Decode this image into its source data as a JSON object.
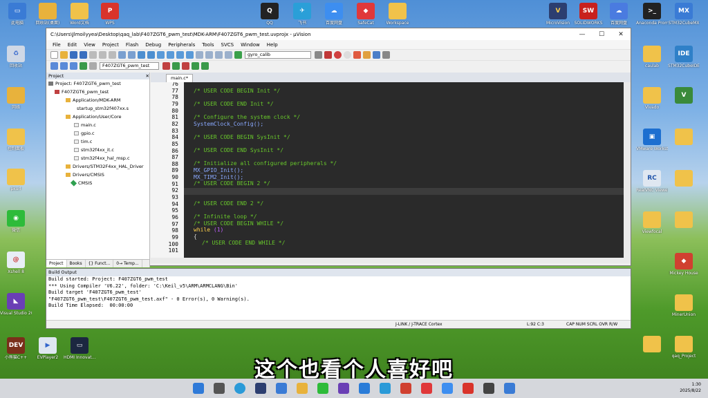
{
  "window": {
    "title": "C:\\Users\\Jlmoilyyea\\Desktop\\qaq_lab\\F407ZGT6_pwm_test\\MDK-ARM\\F407ZGT6_pwm_test.uvprojx - µVision"
  },
  "menu": [
    "File",
    "Edit",
    "View",
    "Project",
    "Flash",
    "Debug",
    "Peripherals",
    "Tools",
    "SVCS",
    "Window",
    "Help"
  ],
  "toolbar": {
    "target_select": "gyro_calib",
    "project_select": "F407ZGT6_pwm_test"
  },
  "project_pane": {
    "title": "Project",
    "tree": [
      "Project: F407ZGT6_pwm_test",
      "F407ZGT6_pwm_test",
      "Application/MDK-ARM",
      "startup_stm32f407xx.s",
      "Application/User/Core",
      "main.c",
      "gpio.c",
      "tim.c",
      "stm32f4xx_it.c",
      "stm32f4xx_hal_msp.c",
      "Drivers/STM32F4xx_HAL_Driver",
      "Drivers/CMSIS",
      "CMSIS"
    ],
    "tabs": [
      "Project",
      "Books",
      "{} Funct...",
      "0→ Temp..."
    ]
  },
  "editor": {
    "tab": "main.c*",
    "line_numbers": [
      "76",
      "77",
      "78",
      "79",
      "80",
      "81",
      "82",
      "83",
      "84",
      "85",
      "86",
      "87",
      "88",
      "89",
      "90",
      "91",
      "92",
      "93",
      "94",
      "95",
      "96",
      "97",
      "98",
      "99",
      "100",
      "101"
    ],
    "lines": {
      "l77": "/* USER CODE BEGIN Init */",
      "l79": "/* USER CODE END Init */",
      "l81": "/* Configure the system clock */",
      "l82": "SystemClock_Config();",
      "l84": "/* USER CODE BEGIN SysInit */",
      "l86": "/* USER CODE END SysInit */",
      "l88": "/* Initialize all configured peripherals */",
      "l89": "MX_GPIO_Init();",
      "l90": "MX_TIM2_Init();",
      "l91": "/* USER CODE BEGIN 2 */",
      "l94": "/* USER CODE END 2 */",
      "l96": "/* Infinite loop */",
      "l97": "/* USER CODE BEGIN WHILE */",
      "l98a": "while",
      "l98b": "(1)",
      "l99": "{",
      "l100": "/* USER CODE END WHILE */"
    }
  },
  "build": {
    "title": "Build Output",
    "lines": [
      "Build started: Project: F407ZGT6_pwm_test",
      "*** Using Compiler 'V6.22', folder: 'C:\\Keil_v5\\ARM\\ARMCLANG\\Bin'",
      "Build target 'F407ZGT6_pwm_test'",
      "\"F407ZGT6_pwm_test\\F407ZGT6_pwm_test.axf\" - 0 Error(s), 0 Warning(s).",
      "Build Time Elapsed:  00:00:00"
    ]
  },
  "status": {
    "debugger": "J-LINK / J-TRACE Cortex",
    "position": "L:92 C:3",
    "flags": "CAP  NUM  SCRL  OVR  R/W"
  },
  "subtitle": "这个也看个人喜好吧",
  "clock": {
    "time": "1:30",
    "date": "2025/8/22"
  },
  "desktop_icons": {
    "top": [
      "此电脑",
      "回收站(桌面)",
      "Word文档",
      "WPS",
      "QQ",
      "飞书",
      "百度网盘",
      "SafeCat",
      "Workspace",
      "MicroVision",
      "SOLIDWORKS",
      "百度网盘",
      "Anaconda Prompt",
      "STM32CubeMX"
    ],
    "left": [
      "回收站",
      "网络",
      "控制面板",
      "Zotero",
      "pkurl",
      "微信",
      "Xshell 8",
      "Visual Studio 2022",
      "小熊猫C++"
    ],
    "right": [
      "caulab",
      "STM32CubeIDE",
      "Vivado",
      "VMware Workstation",
      "RealVNC Viewer",
      "Viewfocal",
      "Mickey House",
      "MinerUnion",
      "qaq_Project"
    ],
    "bottom": [
      "EVPlayer2",
      "HDMI Innovat..."
    ]
  }
}
